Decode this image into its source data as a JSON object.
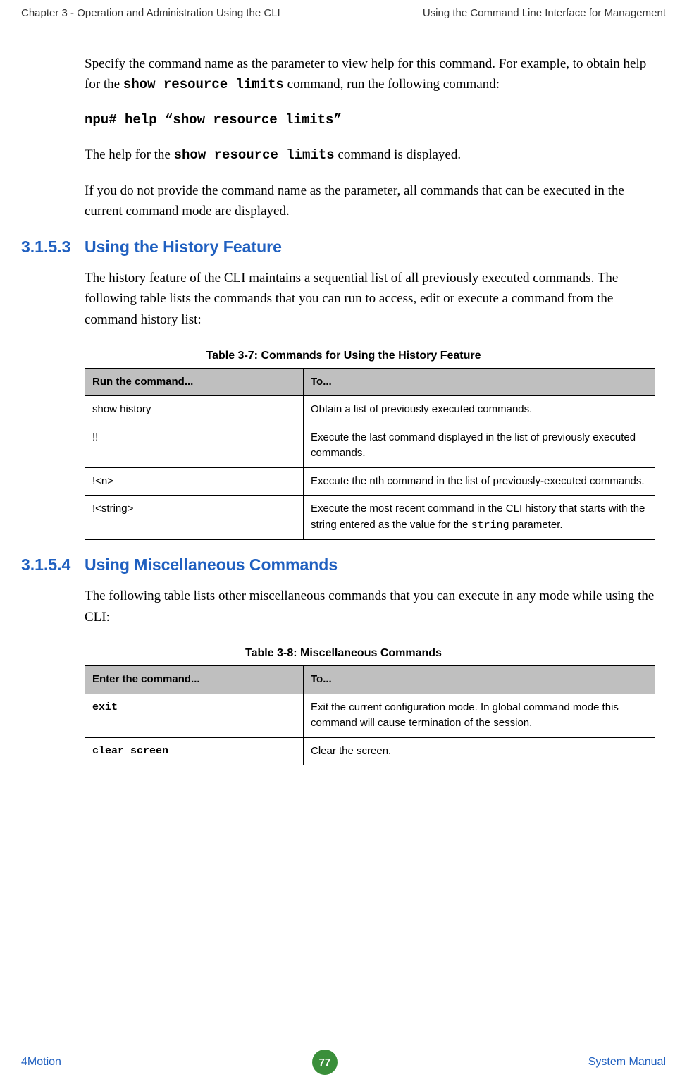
{
  "header": {
    "left": "Chapter 3 - Operation and Administration Using the CLI",
    "right": "Using the Command Line Interface for Management"
  },
  "p1_a": "Specify the command name as the parameter to view help for this command. For example, to obtain help for the ",
  "p1_cmd": "show resource limits",
  "p1_b": " command, run the following command:",
  "p2": "npu# help “show resource limits”",
  "p3_a": "The help for the ",
  "p3_cmd": "show resource limits",
  "p3_b": " command is displayed.",
  "p4": "If you do not provide the command name as the parameter, all commands that can be executed in the current command mode are displayed.",
  "sec1": {
    "num": "3.1.5.3",
    "title": "Using the History Feature"
  },
  "p5": "The history feature of the CLI maintains a sequential list of all previously executed commands. The following table lists the commands that you can run to access, edit or execute a command from the command history list:",
  "table1": {
    "caption": "Table 3-7: Commands for Using the History Feature",
    "h1": "Run the command...",
    "h2": "To...",
    "r1c1": "show history",
    "r1c2": "Obtain a list of previously executed commands.",
    "r2c1": "!!",
    "r2c2": "Execute the last command displayed in the list of previously executed commands.",
    "r3c1": "!<n>",
    "r3c2": "Execute the nth command in the list of previously-executed commands.",
    "r4c1": "!<string>",
    "r4c2_a": "Execute the most recent command in the CLI history that starts with the string entered as the value for the ",
    "r4c2_code": "string",
    "r4c2_b": " parameter."
  },
  "sec2": {
    "num": "3.1.5.4",
    "title": "Using Miscellaneous Commands"
  },
  "p6": "The following table lists other miscellaneous commands that you can execute in any mode while using the CLI:",
  "table2": {
    "caption": "Table 3-8: Miscellaneous Commands",
    "h1": "Enter the command...",
    "h2": "To...",
    "r1c1": "exit",
    "r1c2": "Exit the current configuration mode. In global command mode this command will cause termination of the session.",
    "r2c1": "clear screen",
    "r2c2": "Clear the screen."
  },
  "footer": {
    "left": "4Motion",
    "page": "77",
    "right": "System Manual"
  }
}
